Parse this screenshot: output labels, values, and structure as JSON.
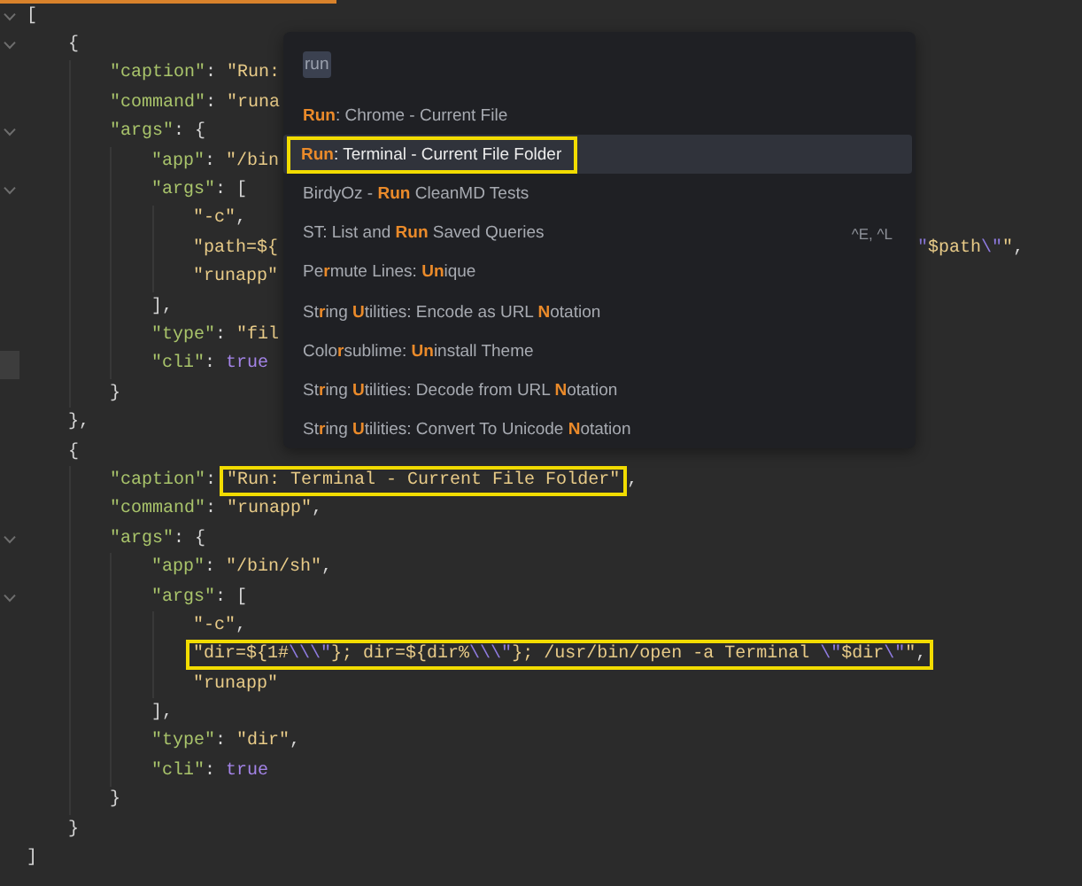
{
  "editor": {
    "lines": [
      {
        "tokens": [
          {
            "kind": "punct",
            "text": "["
          }
        ],
        "foldable": true,
        "children": [
          {
            "tokens": [
              {
                "kind": "punct",
                "text": "{"
              }
            ],
            "foldable": true,
            "children": [
              {
                "tokens": [
                  {
                    "kind": "key",
                    "text": "\"caption\""
                  },
                  {
                    "kind": "punct",
                    "text": ": "
                  },
                  {
                    "kind": "str",
                    "text": "\"Run:"
                  }
                ]
              },
              {
                "tokens": [
                  {
                    "kind": "key",
                    "text": "\"command\""
                  },
                  {
                    "kind": "punct",
                    "text": ": "
                  },
                  {
                    "kind": "str",
                    "text": "\"runa"
                  }
                ]
              },
              {
                "tokens": [
                  {
                    "kind": "key",
                    "text": "\"args\""
                  },
                  {
                    "kind": "punct",
                    "text": ": {"
                  }
                ],
                "foldable": true,
                "children": [
                  {
                    "tokens": [
                      {
                        "kind": "key",
                        "text": "\"app\""
                      },
                      {
                        "kind": "punct",
                        "text": ": "
                      },
                      {
                        "kind": "str",
                        "text": "\"/bin"
                      }
                    ]
                  },
                  {
                    "tokens": [
                      {
                        "kind": "key",
                        "text": "\"args\""
                      },
                      {
                        "kind": "punct",
                        "text": ": ["
                      }
                    ],
                    "foldable": true,
                    "children": [
                      {
                        "tokens": [
                          {
                            "kind": "str",
                            "text": "\"-c\""
                          },
                          {
                            "kind": "punct",
                            "text": ","
                          }
                        ]
                      },
                      {
                        "tokens": [
                          {
                            "kind": "str",
                            "text": "\"path=${"
                          }
                        ],
                        "tail": [
                          {
                            "kind": "esc",
                            "text": "\""
                          },
                          {
                            "kind": "str",
                            "text": "$path"
                          },
                          {
                            "kind": "esc",
                            "text": "\\\""
                          },
                          {
                            "kind": "str",
                            "text": "\""
                          },
                          {
                            "kind": "punct",
                            "text": ","
                          }
                        ]
                      },
                      {
                        "tokens": [
                          {
                            "kind": "str",
                            "text": "\"runapp\""
                          }
                        ]
                      }
                    ]
                  },
                  {
                    "tokens": [
                      {
                        "kind": "punct",
                        "text": "],"
                      }
                    ]
                  },
                  {
                    "tokens": [
                      {
                        "kind": "key",
                        "text": "\"type\""
                      },
                      {
                        "kind": "punct",
                        "text": ": "
                      },
                      {
                        "kind": "str",
                        "text": "\"fil"
                      }
                    ]
                  },
                  {
                    "tokens": [
                      {
                        "kind": "key",
                        "text": "\"cli\""
                      },
                      {
                        "kind": "punct",
                        "text": ": "
                      },
                      {
                        "kind": "bool",
                        "text": "true"
                      }
                    ],
                    "current": true
                  }
                ]
              },
              {
                "tokens": [
                  {
                    "kind": "punct",
                    "text": "}"
                  }
                ]
              }
            ]
          },
          {
            "tokens": [
              {
                "kind": "punct",
                "text": "},"
              }
            ]
          },
          {
            "tokens": [
              {
                "kind": "punct",
                "text": "{"
              }
            ],
            "children": [
              {
                "tokens": [
                  {
                    "kind": "key",
                    "text": "\"caption\""
                  },
                  {
                    "kind": "punct",
                    "text": ": "
                  },
                  {
                    "kind": "boxed",
                    "tokens": [
                      {
                        "kind": "str",
                        "text": "\"Run: Terminal - Current File Folder\""
                      }
                    ]
                  },
                  {
                    "kind": "punct",
                    "text": ","
                  }
                ]
              },
              {
                "tokens": [
                  {
                    "kind": "key",
                    "text": "\"command\""
                  },
                  {
                    "kind": "punct",
                    "text": ": "
                  },
                  {
                    "kind": "str",
                    "text": "\"runapp\""
                  },
                  {
                    "kind": "punct",
                    "text": ","
                  }
                ]
              },
              {
                "tokens": [
                  {
                    "kind": "key",
                    "text": "\"args\""
                  },
                  {
                    "kind": "punct",
                    "text": ": {"
                  }
                ],
                "foldable": true,
                "children": [
                  {
                    "tokens": [
                      {
                        "kind": "key",
                        "text": "\"app\""
                      },
                      {
                        "kind": "punct",
                        "text": ": "
                      },
                      {
                        "kind": "str",
                        "text": "\"/bin/sh\""
                      },
                      {
                        "kind": "punct",
                        "text": ","
                      }
                    ]
                  },
                  {
                    "tokens": [
                      {
                        "kind": "key",
                        "text": "\"args\""
                      },
                      {
                        "kind": "punct",
                        "text": ": ["
                      }
                    ],
                    "foldable": true,
                    "children": [
                      {
                        "tokens": [
                          {
                            "kind": "str",
                            "text": "\"-c\""
                          },
                          {
                            "kind": "punct",
                            "text": ","
                          }
                        ]
                      },
                      {
                        "tokens": [
                          {
                            "kind": "boxed",
                            "tokens": [
                              {
                                "kind": "str",
                                "text": "\"dir=${1#"
                              },
                              {
                                "kind": "esc",
                                "text": "\\\\\\\""
                              },
                              {
                                "kind": "str",
                                "text": "}; dir=${dir%"
                              },
                              {
                                "kind": "esc",
                                "text": "\\\\\\\""
                              },
                              {
                                "kind": "str",
                                "text": "}; /usr/bin/open -a Terminal "
                              },
                              {
                                "kind": "esc",
                                "text": "\\\""
                              },
                              {
                                "kind": "str",
                                "text": "$dir"
                              },
                              {
                                "kind": "esc",
                                "text": "\\\""
                              },
                              {
                                "kind": "str",
                                "text": "\""
                              },
                              {
                                "kind": "punct",
                                "text": ","
                              }
                            ]
                          }
                        ]
                      },
                      {
                        "tokens": [
                          {
                            "kind": "str",
                            "text": "\"runapp\""
                          }
                        ]
                      }
                    ]
                  },
                  {
                    "tokens": [
                      {
                        "kind": "punct",
                        "text": "],"
                      }
                    ]
                  },
                  {
                    "tokens": [
                      {
                        "kind": "key",
                        "text": "\"type\""
                      },
                      {
                        "kind": "punct",
                        "text": ": "
                      },
                      {
                        "kind": "str",
                        "text": "\"dir\""
                      },
                      {
                        "kind": "punct",
                        "text": ","
                      }
                    ]
                  },
                  {
                    "tokens": [
                      {
                        "kind": "key",
                        "text": "\"cli\""
                      },
                      {
                        "kind": "punct",
                        "text": ": "
                      },
                      {
                        "kind": "bool",
                        "text": "true"
                      }
                    ]
                  }
                ]
              },
              {
                "tokens": [
                  {
                    "kind": "punct",
                    "text": "}"
                  }
                ]
              }
            ]
          },
          {
            "tokens": [
              {
                "kind": "punct",
                "text": "}"
              }
            ]
          }
        ]
      },
      {
        "tokens": [
          {
            "kind": "punct",
            "text": "]"
          }
        ]
      }
    ]
  },
  "command_palette": {
    "query": "run",
    "items": [
      {
        "label": "**Run**: Chrome - Current File",
        "selected": false
      },
      {
        "label": "**Run**: Terminal - Current File Folder",
        "selected": true,
        "annotated": true
      },
      {
        "label": "BirdyOz - **Run** CleanMD Tests",
        "selected": false
      },
      {
        "label": "ST: List and **Run** Saved Queries",
        "selected": false,
        "shortcut": "^E, ^L"
      },
      {
        "label": "Pe**r**mute Lines: **Un**ique",
        "selected": false
      },
      {
        "label": "St**r**ing **U**tilities: Encode as URL **N**otation",
        "selected": false
      },
      {
        "label": "Colo**r**sublime: **Un**install Theme",
        "selected": false
      },
      {
        "label": "St**r**ing **U**tilities: Decode from URL **N**otation",
        "selected": false
      },
      {
        "label": "St**r**ing **U**tilities: Convert To Unicode **N**otation",
        "selected": false
      }
    ]
  }
}
